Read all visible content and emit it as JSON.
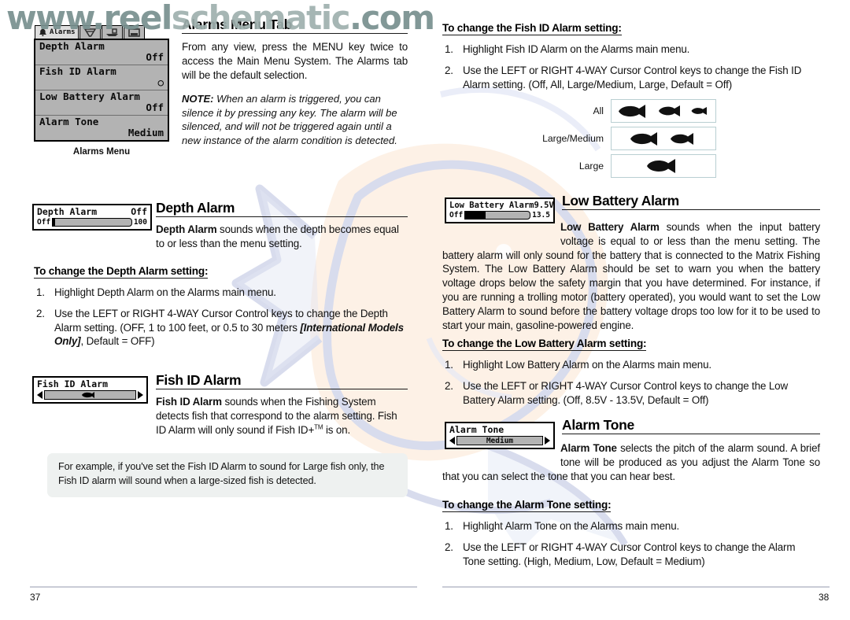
{
  "watermark": {
    "part1": "www.reel",
    "part2": "schematic",
    "part3": ".com"
  },
  "left_page": {
    "page_number": "37",
    "lcd_menu": {
      "active_tab_label": "Alarms",
      "caption": "Alarms Menu",
      "rows": [
        {
          "label": "Depth Alarm",
          "value": "Off"
        },
        {
          "label": "Fish ID Alarm",
          "value": "○"
        },
        {
          "label": "Low Battery Alarm",
          "value": "Off"
        },
        {
          "label": "Alarm Tone",
          "value": "Medium"
        }
      ]
    },
    "section_alarms_tab": {
      "heading": "Alarms Menu Tab",
      "paragraph": "From any view, press the MENU key twice to access the Main Menu System. The Alarms tab will be the default selection.",
      "note_label": "NOTE:",
      "note_text": " When an alarm is triggered, you can silence it by pressing any key.  The alarm will be silenced, and will not be triggered again until a new instance of the alarm condition is detected."
    },
    "section_depth_alarm": {
      "heading": "Depth Alarm",
      "widget": {
        "title": "Depth Alarm",
        "value": "Off",
        "min_label": "Off",
        "max_label": "100"
      },
      "lead_bold": "Depth Alarm",
      "lead_rest": " sounds when the depth becomes equal to or less than the menu setting.",
      "subhead": "To change the Depth Alarm setting:",
      "steps": [
        {
          "num": "1.",
          "text": "Highlight Depth Alarm on the Alarms main menu."
        },
        {
          "num": "2.",
          "pre": "Use the LEFT or RIGHT 4-WAY Cursor Control keys to change the Depth Alarm setting. (OFF, 1 to 100 feet, or 0.5 to 30 meters ",
          "italic": "[International Models Only]",
          "post": ", Default = OFF)"
        }
      ]
    },
    "section_fish_id_alarm": {
      "heading": "Fish ID Alarm",
      "widget": {
        "title": "Fish ID Alarm"
      },
      "lead_bold": "Fish ID Alarm",
      "lead_rest": " sounds when the Fishing System detects fish that correspond to the alarm setting. Fish ID Alarm will only sound if Fish ID+",
      "trademark": "TM",
      "lead_end": " is on.",
      "callout": "For example, if you've set the Fish ID Alarm to sound for Large fish only, the Fish ID alarm will sound when a large-sized fish is detected."
    }
  },
  "right_page": {
    "page_number": "38",
    "section_fish_id_steps": {
      "subhead": "To change the Fish ID Alarm setting:",
      "steps": [
        {
          "num": "1.",
          "text": "Highlight Fish ID Alarm on the Alarms main menu."
        },
        {
          "num": "2.",
          "text": "Use the LEFT or RIGHT 4-WAY Cursor Control keys to change the Fish ID Alarm setting. (Off, All, Large/Medium, Large, Default = Off)"
        }
      ],
      "fish_table": [
        {
          "label": "All",
          "count": 3
        },
        {
          "label": "Large/Medium",
          "count": 2
        },
        {
          "label": "Large",
          "count": 1
        }
      ]
    },
    "section_low_battery": {
      "heading": "Low Battery Alarm",
      "widget": {
        "title": "Low Battery Alarm",
        "value": "9.5V",
        "min_label": "Off",
        "max_label": "13.5"
      },
      "lead_bold": "Low Battery Alarm",
      "lead_rest": " sounds when the input battery voltage is equal to or less than the menu setting. The battery alarm will only sound for the battery that is connected to the Matrix Fishing System. The Low Battery Alarm should be set to warn you when the battery voltage drops below the safety margin that you have determined. For instance, if you are running a trolling motor (battery operated), you would want to set the Low Battery Alarm to sound before the battery voltage drops too low for it to be used to start your main, gasoline-powered engine.",
      "subhead": "To change the Low Battery Alarm setting:",
      "steps": [
        {
          "num": "1.",
          "text": "Highlight Low Battery Alarm on the Alarms main menu."
        },
        {
          "num": "2.",
          "text": "Use the LEFT or RIGHT 4-WAY Cursor Control keys to change the Low Battery Alarm setting. (Off, 8.5V - 13.5V,  Default = Off)"
        }
      ]
    },
    "section_alarm_tone": {
      "heading": "Alarm Tone",
      "widget": {
        "title": "Alarm Tone",
        "value": "Medium"
      },
      "lead_bold": "Alarm Tone",
      "lead_rest": " selects the pitch of the alarm sound. A brief tone will be produced as you adjust the Alarm Tone so that you can select the tone that you can hear best.",
      "subhead": "To change the Alarm Tone setting:",
      "steps": [
        {
          "num": "1.",
          "text": "Highlight Alarm Tone on the Alarms main menu."
        },
        {
          "num": "2.",
          "text": "Use the LEFT or RIGHT 4-WAY Cursor Control keys to change the Alarm Tone setting. (High, Medium, Low, Default = Medium)"
        }
      ]
    }
  },
  "colors": {
    "watermark_dark": "#78908f",
    "watermark_light": "#9fb0ae",
    "lcd_background": "#b3b3b3",
    "art_blue": "#b9c0e0",
    "art_peach": "#fae0c8",
    "callout_bg": "#eef1f0"
  }
}
